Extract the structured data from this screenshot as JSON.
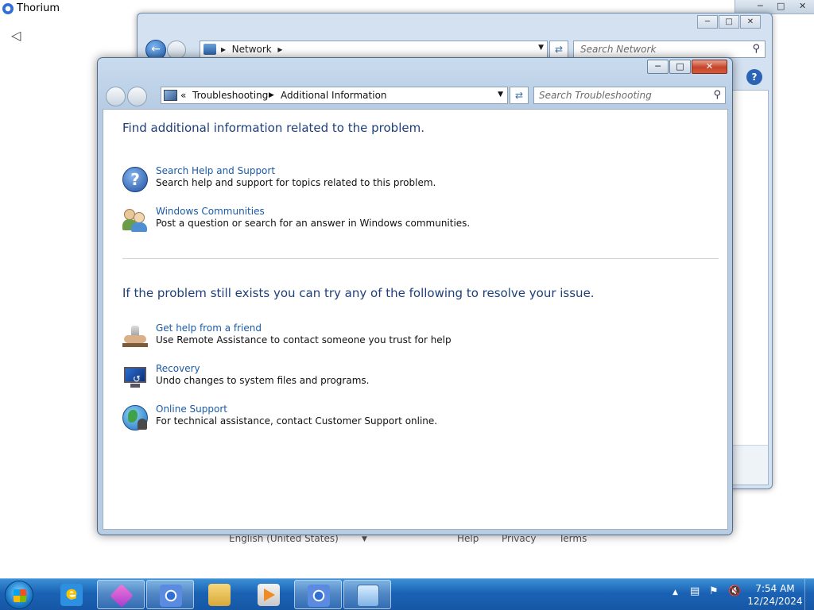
{
  "browser": {
    "title": "Thorium",
    "back_icon": "◁",
    "footer": {
      "language": "English (United States)",
      "language_arrow": "▼",
      "help": "Help",
      "privacy": "Privacy",
      "terms": "Terms"
    }
  },
  "network_window": {
    "breadcrumb": "Network",
    "search_placeholder": "Search Network"
  },
  "ts_window": {
    "breadcrumb_root": "Troubleshooting",
    "breadcrumb_current": "Additional Information",
    "search_placeholder": "Search Troubleshooting",
    "heading1": "Find additional information related to the problem.",
    "heading2": "If the problem still exists you can try any of the following to resolve your issue.",
    "items_top": [
      {
        "link": "Search Help and Support",
        "desc": "Search help and support for topics related to this problem."
      },
      {
        "link": "Windows Communities",
        "desc": "Post a question or search for an answer in Windows communities."
      }
    ],
    "items_bottom": [
      {
        "link": "Get help from a friend",
        "desc": "Use Remote Assistance to contact someone you trust for help"
      },
      {
        "link": "Recovery",
        "desc": "Undo changes to system files and programs."
      },
      {
        "link": "Online Support",
        "desc": "For technical assistance, contact Customer Support online."
      }
    ]
  },
  "taskbar": {
    "time": "7:54 AM",
    "date": "12/24/2024"
  },
  "colors": {
    "link": "#1a5aa6",
    "heading": "#1e3f7a",
    "taskbar": "#1b62b4"
  }
}
